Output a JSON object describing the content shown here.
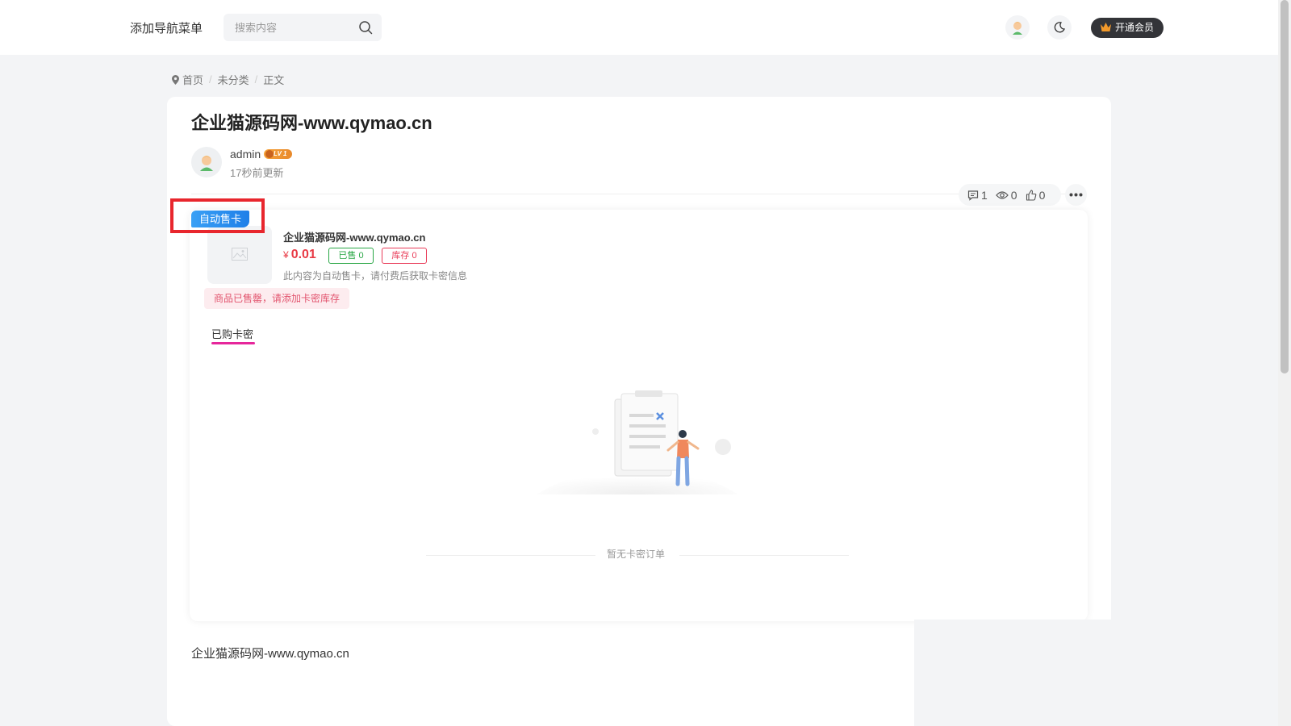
{
  "header": {
    "nav_label": "添加导航菜单",
    "search_placeholder": "搜索内容",
    "vip_label": "开通会员"
  },
  "breadcrumb": {
    "items": [
      "首页",
      "未分类",
      "正文"
    ]
  },
  "article": {
    "title": "企业猫源码网-www.qymao.cn",
    "author": "admin",
    "level": "LV 1",
    "updated": "17秒前更新",
    "stats": {
      "comments": "1",
      "views": "0",
      "likes": "0"
    },
    "body_text": "企业猫源码网-www.qymao.cn"
  },
  "sale": {
    "tag": "自动售卡",
    "product_name": "企业猫源码网-www.qymao.cn",
    "currency": "¥",
    "price": "0.01",
    "sold_label": "已售 0",
    "stock_label": "库存 0",
    "description": "此内容为自动售卡，请付费后获取卡密信息",
    "soldout_notice": "商品已售罄，请添加卡密库存",
    "tab_label": "已购卡密",
    "empty_text": "暂无卡密订单"
  },
  "colors": {
    "accent_blue": "#1e7fe8",
    "price_red": "#e83a45",
    "sold_green": "#29a745",
    "highlight_red": "#e8262d",
    "tab_pink": "#e6269b"
  }
}
